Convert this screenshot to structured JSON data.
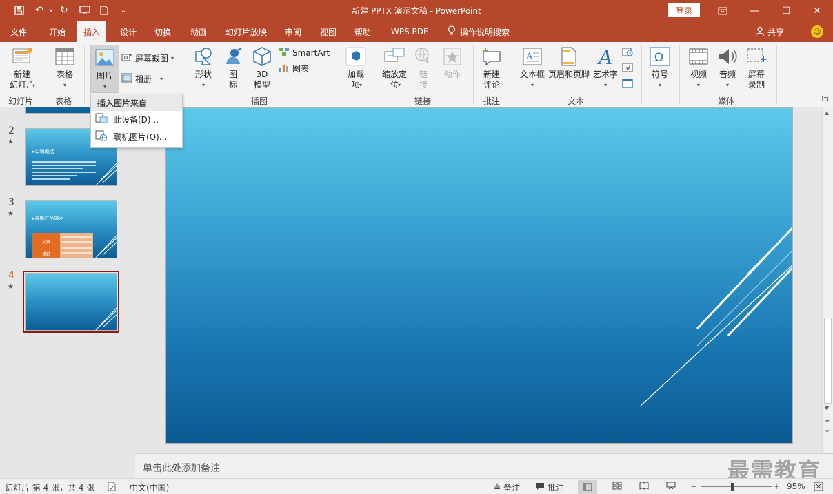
{
  "window": {
    "title": "新建 PPTX 演示文稿  -  PowerPoint",
    "login": "登录"
  },
  "tabs": [
    {
      "label": "文件"
    },
    {
      "label": "开始"
    },
    {
      "label": "插入"
    },
    {
      "label": "设计"
    },
    {
      "label": "切换"
    },
    {
      "label": "动画"
    },
    {
      "label": "幻灯片放映"
    },
    {
      "label": "审阅"
    },
    {
      "label": "视图"
    },
    {
      "label": "帮助"
    },
    {
      "label": "WPS PDF"
    },
    {
      "label": "操作说明搜索"
    }
  ],
  "share": "共享",
  "ribbon": {
    "new_slide": "新建\n幻灯片",
    "table": "表格",
    "picture": "图片",
    "screenshot": "屏幕截图",
    "album": "相册",
    "shapes": "形状",
    "icons": "图\n标",
    "model3d": "3D\n模型",
    "smartart": "SmartArt",
    "chart": "图表",
    "addins": "加载\n项",
    "zoom": "缩放定\n位",
    "link": "链\n接",
    "action": "动作",
    "new_comment": "新建\n评论",
    "textbox": "文本框",
    "header_footer": "页眉和页脚",
    "wordart": "艺术字",
    "symbol": "符号",
    "video": "视频",
    "audio": "音频",
    "screen_record": "屏幕\n录制",
    "groups": {
      "slides": "幻灯片",
      "tables": "表格",
      "illustrations": "插图",
      "links": "链接",
      "comments": "批注",
      "text": "文本",
      "media": "媒体"
    }
  },
  "dropdown": {
    "header": "插入图片来自",
    "items": [
      {
        "label": "此设备(D)..."
      },
      {
        "label": "联机图片(O)..."
      }
    ]
  },
  "slides": {
    "numbers": [
      "2",
      "3",
      "4"
    ],
    "thumb2_title": "公司概括",
    "thumb3_title": "最新产品展示",
    "thumb3_cell1": "文具",
    "thumb3_cell2": "措纸"
  },
  "notes_placeholder": "单击此处添加备注",
  "watermark": "最需教育",
  "status": {
    "slide_info": "幻灯片 第 4 张，共 4 张",
    "language": "中文(中国)",
    "notes": "备注",
    "comments": "批注",
    "zoom": "95%"
  },
  "colors": {
    "accent": "#b7472a",
    "selected_slide": "#8b1a1a"
  }
}
